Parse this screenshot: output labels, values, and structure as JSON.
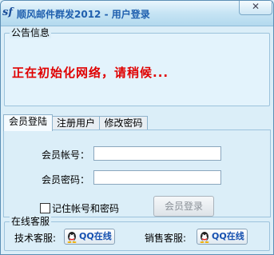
{
  "window": {
    "icon_glyph": "sf",
    "title": "顺风邮件群发2012 - 用户登录",
    "close_glyph": "✕"
  },
  "announcement": {
    "legend": "公告信息",
    "message": "正在初始化网络，请稍候..."
  },
  "tabs": [
    {
      "label": "会员登陆",
      "active": true
    },
    {
      "label": "注册用户",
      "active": false
    },
    {
      "label": "修改密码",
      "active": false
    }
  ],
  "login": {
    "account_label": "会员帐号：",
    "account_value": "",
    "password_label": "会员密码：",
    "password_value": "",
    "remember_label": "记住帐号和密码",
    "remember_checked": false,
    "login_button": "会员登录"
  },
  "support": {
    "legend": "在线客服",
    "tech_label": "技术客服:",
    "sales_label": "销售客服:",
    "qq_button": "QQ在线"
  },
  "colors": {
    "title": "#1f5fae",
    "notice": "#e00000",
    "background": "#dbeef8"
  }
}
